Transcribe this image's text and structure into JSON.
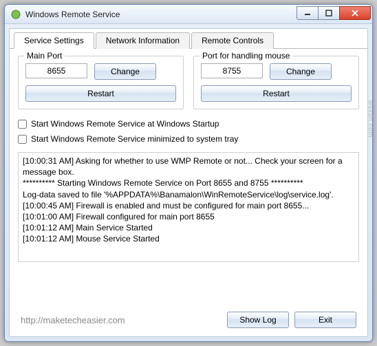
{
  "window": {
    "title": "Windows Remote Service"
  },
  "tabs": {
    "settings": "Service Settings",
    "network": "Network Information",
    "remote": "Remote Controls"
  },
  "mainPort": {
    "legend": "Main Port",
    "value": "8655",
    "change": "Change",
    "restart": "Restart"
  },
  "mousePort": {
    "legend": "Port for handling mouse",
    "value": "8755",
    "change": "Change",
    "restart": "Restart"
  },
  "checks": {
    "startup": "Start Windows Remote Service at Windows Startup",
    "tray": "Start Windows Remote Service minimized to system tray"
  },
  "log": {
    "text": "[10:00:31 AM] Asking for whether to use WMP Remote or not... Check your screen for a\nmessage box.\n********** Starting Windows Remote Service on Port 8655 and 8755 **********\nLog-data saved to file '%APPDATA%\\Banamalon\\WinRemoteService\\log\\service.log'.\n[10:00:45 AM] Firewall is enabled and must be configured for main port 8655...\n[10:01:00 AM] Firewall configured for main port 8655\n[10:01:12 AM] Main Service Started\n[10:01:12 AM] Mouse Service Started"
  },
  "footer": {
    "showLog": "Show Log",
    "exit": "Exit",
    "watermark": "http://maketecheasier.com",
    "side": "wsxdn.com"
  }
}
